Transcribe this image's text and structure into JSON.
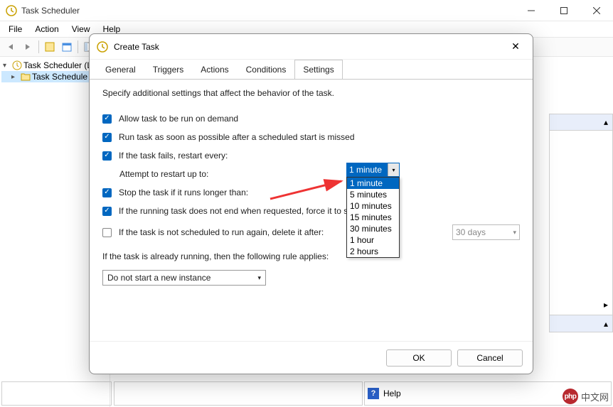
{
  "window": {
    "title": "Task Scheduler",
    "menu": [
      "File",
      "Action",
      "View",
      "Help"
    ]
  },
  "tree": {
    "root": "Task Scheduler (L",
    "child": "Task Schedule"
  },
  "status": {
    "help": "Help"
  },
  "dialog": {
    "title": "Create Task",
    "tabs": [
      "General",
      "Triggers",
      "Actions",
      "Conditions",
      "Settings"
    ],
    "description": "Specify additional settings that affect the behavior of the task.",
    "s1": "Allow task to be run on demand",
    "s2": "Run task as soon as possible after a scheduled start is missed",
    "s3": "If the task fails, restart every:",
    "s4": "Attempt to restart up to:",
    "s5": "Stop the task if it runs longer than:",
    "s6": "If the running task does not end when requested, force it to st",
    "s7": "If the task is not scheduled to run again, delete it after:",
    "s8": "If the task is already running, then the following rule applies:",
    "days_value": "30 days",
    "rule_value": "Do not start a new instance",
    "ok": "OK",
    "cancel": "Cancel"
  },
  "dropdown": {
    "selected": "1 minute",
    "options": [
      "1 minute",
      "5 minutes",
      "10 minutes",
      "15 minutes",
      "30 minutes",
      "1 hour",
      "2 hours"
    ]
  },
  "watermark": {
    "brand": "php",
    "text": "中文网"
  }
}
